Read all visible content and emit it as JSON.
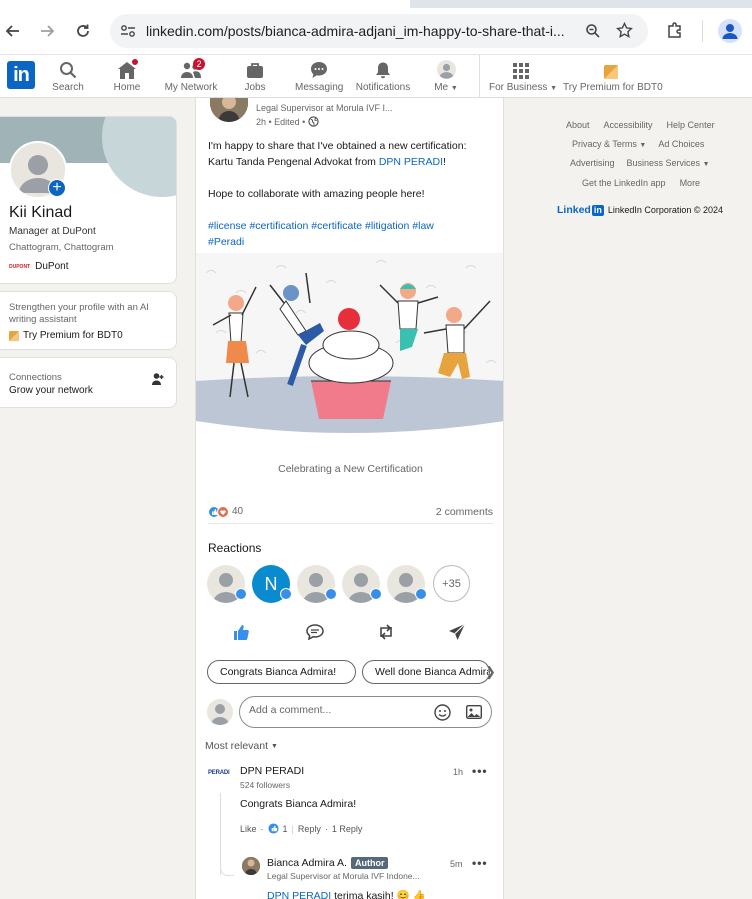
{
  "browser": {
    "url": "linkedin.com/posts/bianca-admira-adjani_im-happy-to-share-that-i..."
  },
  "nav": {
    "logo": "in",
    "items": [
      {
        "label": "Search"
      },
      {
        "label": "Home"
      },
      {
        "label": "My Network",
        "badge": "2"
      },
      {
        "label": "Jobs"
      },
      {
        "label": "Messaging"
      },
      {
        "label": "Notifications"
      },
      {
        "label": "Me"
      },
      {
        "label": "For Business"
      },
      {
        "label": "Try Premium for BDT0"
      }
    ]
  },
  "profile": {
    "name": "Kii Kinad",
    "title": "Manager at DuPont",
    "location": "Chattogram, Chattogram",
    "company": "DuPont",
    "company_logo_text": "DUPONT"
  },
  "premium_card": {
    "text": "Strengthen your profile with an AI writing assistant",
    "cta": "Try Premium for BDT0"
  },
  "connections_card": {
    "title": "Connections",
    "subtitle": "Grow your network"
  },
  "post": {
    "author_headline": "Legal Supervisor at Morula IVF I...",
    "meta": "2h • Edited •",
    "text_line1": "I'm happy to share that I've obtained a new certification:",
    "text_line2a": "Kartu Tanda Pengenal Advokat from ",
    "text_link": "DPN PERADI",
    "text_line2b": "!",
    "text_line3": "Hope to collaborate with amazing people here!",
    "hashtags_line1": "#license #certification #certificate #litigation #law",
    "hashtags_line2": "#Peradi",
    "image_caption": "Celebrating a New Certification",
    "reaction_count": "40",
    "comment_count": "2 comments"
  },
  "reactions": {
    "title": "Reactions",
    "n_letter": "N",
    "more": "+35"
  },
  "suggestions": [
    "Congrats Bianca Admira!",
    "Well done Bianca Admira!"
  ],
  "comment_box": {
    "placeholder": "Add a comment..."
  },
  "sort_label": "Most relevant",
  "comments": [
    {
      "logo_text": "PERADI",
      "name": "DPN PERADI",
      "followers": "524 followers",
      "time": "1h",
      "text": "Congrats Bianca Admira!",
      "like": "Like",
      "like_count": "1",
      "reply": "Reply",
      "reply_count": "1 Reply"
    },
    {
      "name": "Bianca Admira A.",
      "badge": "Author",
      "headline": "Legal Supervisor at Morula IVF Indone...",
      "time": "5m",
      "mention": "DPN PERADI",
      "text": " terima kasih! 😊 👍"
    }
  ],
  "footer": {
    "links": [
      "About",
      "Accessibility",
      "Help Center",
      "Privacy & Terms",
      "Ad Choices",
      "Advertising",
      "Business Services",
      "Get the LinkedIn app",
      "More"
    ],
    "brand": "Linked",
    "brand_in": "in",
    "copyright": "LinkedIn Corporation © 2024"
  },
  "colors": {
    "brand_blue": "#0a66c2",
    "badge_red": "#cb112d",
    "page_bg": "#f4f2ee"
  }
}
